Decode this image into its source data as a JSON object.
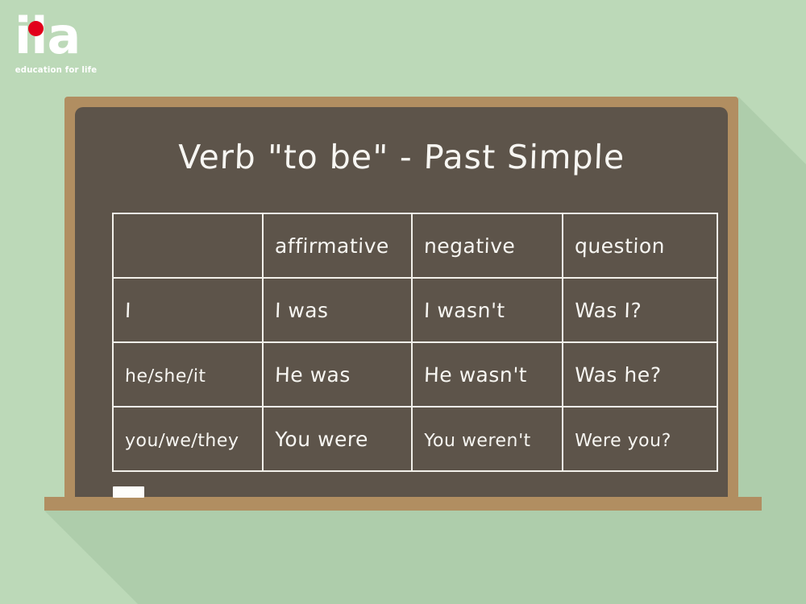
{
  "page": {
    "background_color": "#bcd9b8",
    "shadow_color": "#aecdab"
  },
  "logo": {
    "wordmark": "ila",
    "tagline": "education for life",
    "dot_color": "#e2001a",
    "text_color": "#ffffff",
    "dot_icon": "logo-dot-icon"
  },
  "chalkboard": {
    "frame_color": "#b18e61",
    "board_color": "#5d544a",
    "chalk_color": "#fdfdfb",
    "title": "Verb \"to be\" - Past Simple",
    "chalk_icon": "chalk-stick-icon",
    "ledge_name": "chalk-ledge"
  },
  "table": {
    "border_color": "#f2f0ea",
    "text_color": "#f7f6f2",
    "headers": [
      "",
      "affirmative",
      "negative",
      "question"
    ],
    "rows": [
      {
        "subject": "I",
        "affirmative": "I was",
        "negative": "I wasn't",
        "question": "Was I?"
      },
      {
        "subject": "he/she/it",
        "affirmative": "He was",
        "negative": "He wasn't",
        "question": "Was he?"
      },
      {
        "subject": "you/we/they",
        "affirmative": "You were",
        "negative": "You weren't",
        "question": "Were you?"
      }
    ]
  }
}
